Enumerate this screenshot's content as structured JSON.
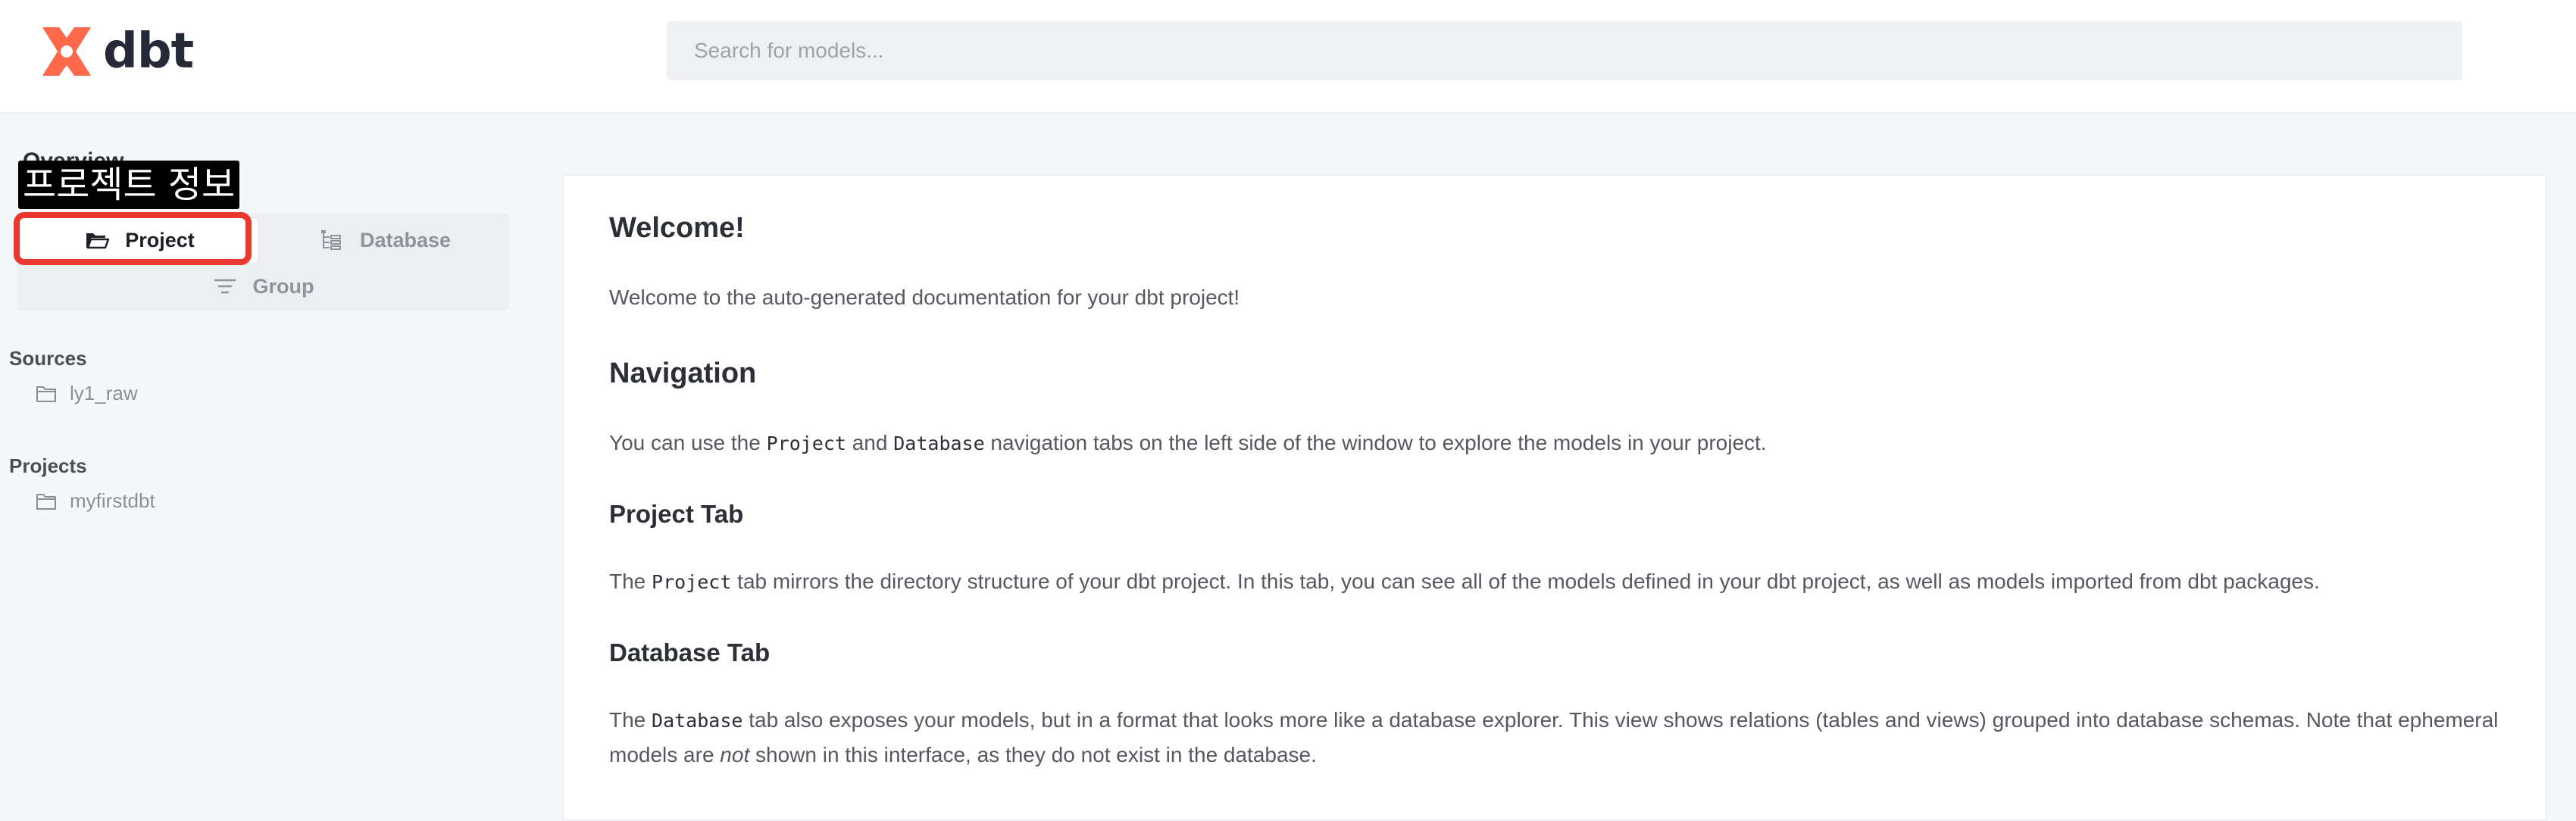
{
  "brand": {
    "name": "dbt",
    "accent": "#ff694b"
  },
  "search": {
    "placeholder": "Search for models..."
  },
  "sidebar": {
    "overview_title": "Overview",
    "annotation": "프로젝트 정보",
    "tabs": {
      "project": "Project",
      "database": "Database",
      "group": "Group"
    },
    "sources_header": "Sources",
    "sources": [
      {
        "label": "ly1_raw",
        "icon": "folder-icon"
      }
    ],
    "projects_header": "Projects",
    "projects": [
      {
        "label": "myfirstdbt",
        "icon": "folder-icon"
      }
    ]
  },
  "content": {
    "welcome_title": "Welcome!",
    "welcome_text": "Welcome to the auto-generated documentation for your dbt project!",
    "nav_title": "Navigation",
    "nav_text_1": "You can use the ",
    "nav_code_1": "Project",
    "nav_text_2": " and ",
    "nav_code_2": "Database",
    "nav_text_3": " navigation tabs on the left side of the window to explore the models in your project.",
    "project_tab_title": "Project Tab",
    "project_text_1": "The ",
    "project_code": "Project",
    "project_text_2": " tab mirrors the directory structure of your dbt project. In this tab, you can see all of the models defined in your dbt project, as well as models imported from dbt packages.",
    "database_tab_title": "Database Tab",
    "db_text_1": "The ",
    "db_code": "Database",
    "db_text_2": " tab also exposes your models, but in a format that looks more like a database explorer. This view shows relations (tables and views) grouped into database schemas. Note that ephemeral models are ",
    "db_em": "not",
    "db_text_3": " shown in this interface, as they do not exist in the database."
  }
}
